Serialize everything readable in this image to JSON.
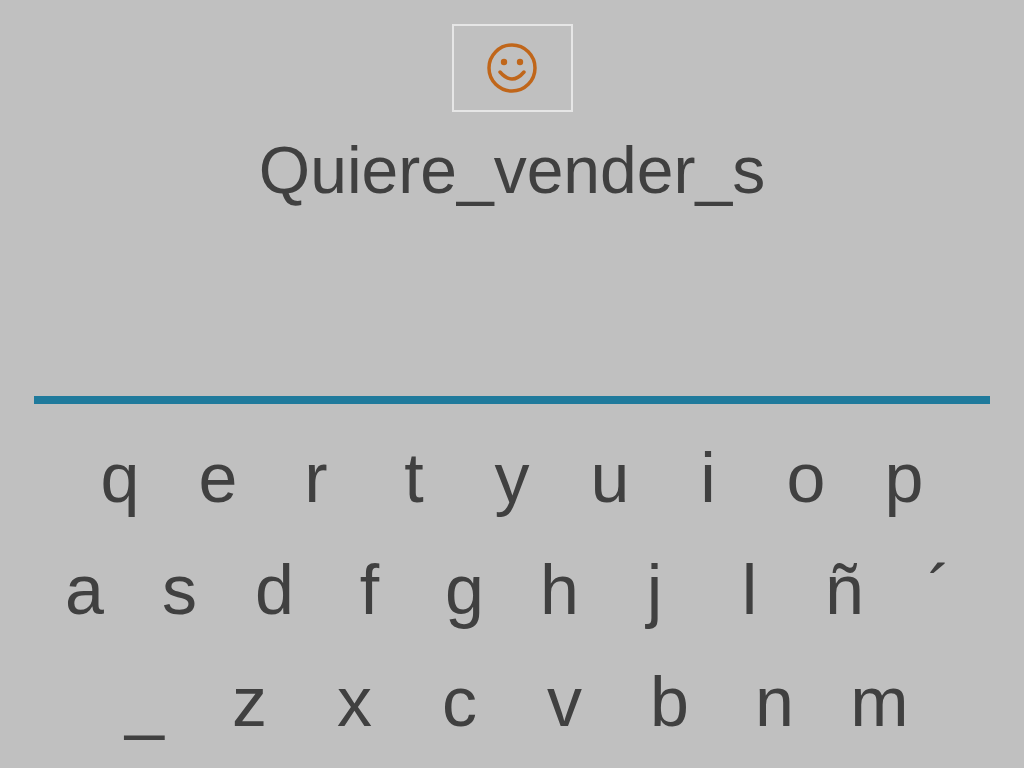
{
  "prompt": "Quiere_vender_s",
  "keyboard": {
    "rows": [
      [
        "q",
        "e",
        "r",
        "t",
        "y",
        "u",
        "i",
        "o",
        "p"
      ],
      [
        "a",
        "s",
        "d",
        "f",
        "g",
        "h",
        "j",
        "l",
        "ñ",
        "´"
      ],
      [
        "_",
        "z",
        "x",
        "c",
        "v",
        "b",
        "n",
        "m"
      ]
    ]
  }
}
